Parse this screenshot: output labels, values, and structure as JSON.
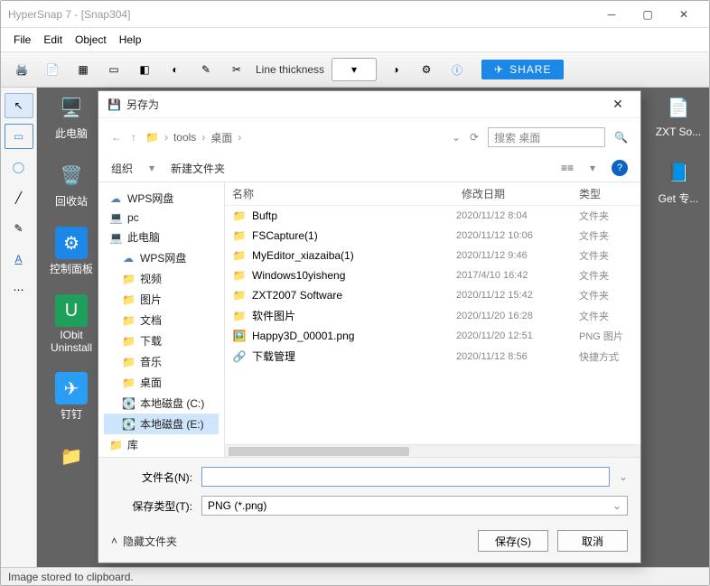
{
  "app_title": "HyperSnap 7 - [Snap304]",
  "menubar": [
    "File",
    "Edit",
    "Object",
    "Help"
  ],
  "toolbar": {
    "line_thickness": "Line thickness",
    "share": "SHARE"
  },
  "statusbar": "Image stored to clipboard.",
  "desktop": {
    "left": [
      {
        "label": "此电脑"
      },
      {
        "label": "回收站"
      },
      {
        "label": "控制面板"
      },
      {
        "label": "IObit Uninstall"
      },
      {
        "label": "钉钉"
      },
      {
        "label": ""
      }
    ],
    "right": [
      {
        "label": "ZXT So..."
      },
      {
        "label": "Get 专..."
      }
    ]
  },
  "dialog": {
    "title": "另存为",
    "breadcrumb": [
      "tools",
      "桌面"
    ],
    "search_placeholder": "搜索 桌面",
    "org": "组织",
    "new_folder": "新建文件夹",
    "view": "≡≡",
    "tree": [
      {
        "icon": "cloud",
        "label": "WPS网盘",
        "indent": 0
      },
      {
        "icon": "pc",
        "label": "pc",
        "indent": 0
      },
      {
        "icon": "pc",
        "label": "此电脑",
        "indent": 0,
        "expanded": true
      },
      {
        "icon": "cloud",
        "label": "WPS网盘",
        "indent": 1
      },
      {
        "icon": "folder",
        "label": "视频",
        "indent": 1
      },
      {
        "icon": "folder",
        "label": "图片",
        "indent": 1
      },
      {
        "icon": "folder",
        "label": "文档",
        "indent": 1
      },
      {
        "icon": "folder",
        "label": "下载",
        "indent": 1
      },
      {
        "icon": "folder",
        "label": "音乐",
        "indent": 1
      },
      {
        "icon": "folder",
        "label": "桌面",
        "indent": 1
      },
      {
        "icon": "disk",
        "label": "本地磁盘 (C:)",
        "indent": 1
      },
      {
        "icon": "disk",
        "label": "本地磁盘 (E:)",
        "indent": 1,
        "selected": true
      },
      {
        "icon": "folder",
        "label": "库",
        "indent": 0
      }
    ],
    "columns": {
      "name": "名称",
      "date": "修改日期",
      "type": "类型"
    },
    "rows": [
      {
        "icon": "folder",
        "name": "Buftp",
        "date": "2020/11/12 8:04",
        "type": "文件夹"
      },
      {
        "icon": "folder",
        "name": "FSCapture(1)",
        "date": "2020/11/12 10:06",
        "type": "文件夹"
      },
      {
        "icon": "folder",
        "name": "MyEditor_xiazaiba(1)",
        "date": "2020/11/12 9:46",
        "type": "文件夹"
      },
      {
        "icon": "folder",
        "name": "Windows10yisheng",
        "date": "2017/4/10 16:42",
        "type": "文件夹"
      },
      {
        "icon": "folder",
        "name": "ZXT2007 Software",
        "date": "2020/11/12 15:42",
        "type": "文件夹"
      },
      {
        "icon": "folder",
        "name": "软件图片",
        "date": "2020/11/20 16:28",
        "type": "文件夹"
      },
      {
        "icon": "png",
        "name": "Happy3D_00001.png",
        "date": "2020/11/20 12:51",
        "type": "PNG 图片"
      },
      {
        "icon": "app",
        "name": "下载管理",
        "date": "2020/11/12 8:56",
        "type": "快捷方式"
      }
    ],
    "filename_label": "文件名(N):",
    "filename_value": "",
    "filetype_label": "保存类型(T):",
    "filetype_value": "PNG (*.png)",
    "hide_folders": "隐藏文件夹",
    "save_btn": "保存(S)",
    "cancel_btn": "取消"
  }
}
